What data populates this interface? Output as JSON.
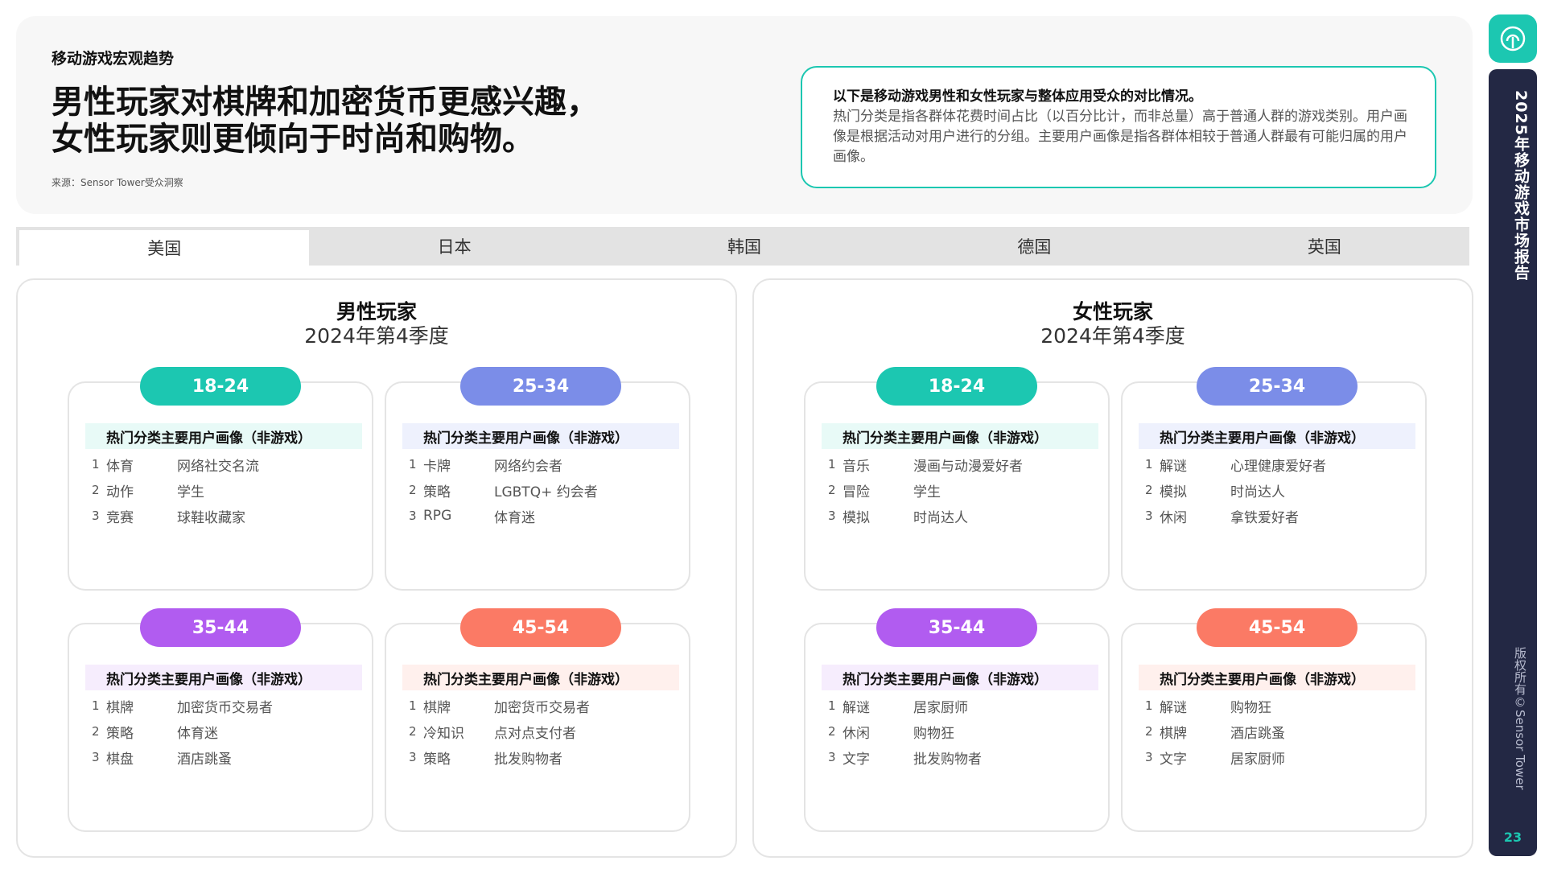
{
  "header": {
    "kicker": "移动游戏宏观趋势",
    "headline_line1": "男性玩家对棋牌和加密货币更感兴趣，",
    "headline_line2": "女性玩家则更倾向于时尚和购物。",
    "source": "来源：Sensor Tower受众洞察",
    "info_title": "以下是移动游戏男性和女性玩家与整体应用受众的对比情况。",
    "info_body": "热门分类是指各群体花费时间占比（以百分比计，而非总量）高于普通人群的游戏类别。用户画像是根据活动对用户进行的分组。主要用户画像是指各群体相较于普通人群最有可能归属的用户画像。"
  },
  "tabs": [
    "美国",
    "日本",
    "韩国",
    "德国",
    "英国"
  ],
  "table_headers": {
    "category": "热门分类",
    "persona": "主要用户画像（非游戏）"
  },
  "male": {
    "title": "男性玩家",
    "subtitle": "2024年第4季度",
    "groups": [
      {
        "age": "18-24",
        "rows": [
          {
            "n": "1",
            "cat": "体育",
            "per": "网络社交名流"
          },
          {
            "n": "2",
            "cat": "动作",
            "per": "学生"
          },
          {
            "n": "3",
            "cat": "竞赛",
            "per": "球鞋收藏家"
          }
        ]
      },
      {
        "age": "25-34",
        "rows": [
          {
            "n": "1",
            "cat": "卡牌",
            "per": "网络约会者"
          },
          {
            "n": "2",
            "cat": "策略",
            "per": "LGBTQ+ 约会者"
          },
          {
            "n": "3",
            "cat": "RPG",
            "per": "体育迷"
          }
        ]
      },
      {
        "age": "35-44",
        "rows": [
          {
            "n": "1",
            "cat": "棋牌",
            "per": "加密货币交易者"
          },
          {
            "n": "2",
            "cat": "策略",
            "per": "体育迷"
          },
          {
            "n": "3",
            "cat": "棋盘",
            "per": "酒店跳蚤"
          }
        ]
      },
      {
        "age": "45-54",
        "rows": [
          {
            "n": "1",
            "cat": "棋牌",
            "per": "加密货币交易者"
          },
          {
            "n": "2",
            "cat": "冷知识",
            "per": "点对点支付者"
          },
          {
            "n": "3",
            "cat": "策略",
            "per": "批发购物者"
          }
        ]
      }
    ]
  },
  "female": {
    "title": "女性玩家",
    "subtitle": "2024年第4季度",
    "groups": [
      {
        "age": "18-24",
        "rows": [
          {
            "n": "1",
            "cat": "音乐",
            "per": "漫画与动漫爱好者"
          },
          {
            "n": "2",
            "cat": "冒险",
            "per": "学生"
          },
          {
            "n": "3",
            "cat": "模拟",
            "per": "时尚达人"
          }
        ]
      },
      {
        "age": "25-34",
        "rows": [
          {
            "n": "1",
            "cat": "解谜",
            "per": "心理健康爱好者"
          },
          {
            "n": "2",
            "cat": "模拟",
            "per": "时尚达人"
          },
          {
            "n": "3",
            "cat": "休闲",
            "per": "拿铁爱好者"
          }
        ]
      },
      {
        "age": "35-44",
        "rows": [
          {
            "n": "1",
            "cat": "解谜",
            "per": "居家厨师"
          },
          {
            "n": "2",
            "cat": "休闲",
            "per": "购物狂"
          },
          {
            "n": "3",
            "cat": "文字",
            "per": "批发购物者"
          }
        ]
      },
      {
        "age": "45-54",
        "rows": [
          {
            "n": "1",
            "cat": "解谜",
            "per": "购物狂"
          },
          {
            "n": "2",
            "cat": "棋牌",
            "per": "酒店跳蚤"
          },
          {
            "n": "3",
            "cat": "文字",
            "per": "居家厨师"
          }
        ]
      }
    ]
  },
  "sidebar": {
    "title": "2025年移动游戏市场报告",
    "copyright": "版权所有©Sensor Tower",
    "page": "23",
    "logo_icon": "sensor-tower-logo-icon"
  },
  "colors": {
    "teal": "#1cc7b1",
    "blue": "#7b8de8",
    "purple": "#b15cf0",
    "coral": "#fb7a65",
    "navy": "#232844"
  }
}
